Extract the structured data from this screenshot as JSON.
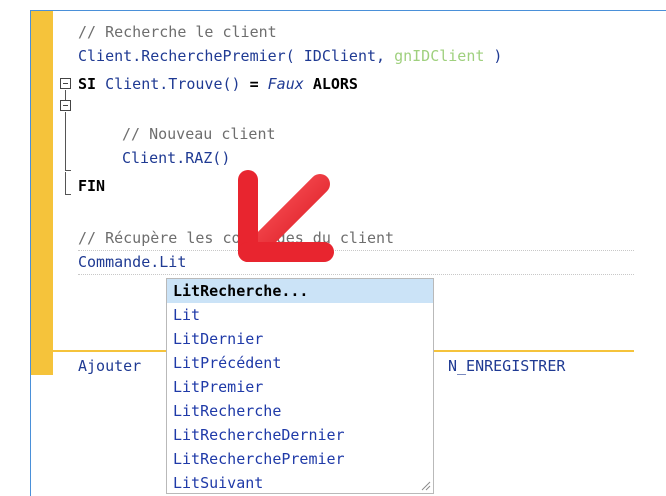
{
  "code": {
    "comment_search": "// Recherche le client",
    "call_object": "Client",
    "call_method": ".RecherchePremier( ",
    "call_arg1": "IDClient",
    "call_sep": ", ",
    "call_arg2": "gnIDClient",
    "call_end": " )",
    "si_kw": "SI",
    "si_object": "Client",
    "si_method": ".Trouve()",
    "si_eq": " = ",
    "si_value": "Faux",
    "alors_kw": "ALORS",
    "comment_new": "// Nouveau client",
    "raz_object": "Client",
    "raz_method": ".RAZ()",
    "fin_kw": "FIN",
    "comment_orders": "// Récupère les commandes du client",
    "cmd_object": "Commande",
    "cmd_method": ".Lit",
    "bottom_left": "Ajouter",
    "bottom_right": "N_ENREGISTRER"
  },
  "autocomplete": {
    "items": [
      "LitRecherche...",
      "Lit",
      "LitDernier",
      "LitPrécédent",
      "LitPremier",
      "LitRecherche",
      "LitRechercheDernier",
      "LitRecherchePremier",
      "LitSuivant"
    ],
    "selected_index": 0
  },
  "colors": {
    "gutter": "#f5c33b",
    "selection": "#cbe3f7",
    "identifier": "#1f3a93",
    "arrow": "#e8252f"
  },
  "icons": {
    "arrow": "red-arrow-icon",
    "grip": "resize-grip-icon"
  }
}
